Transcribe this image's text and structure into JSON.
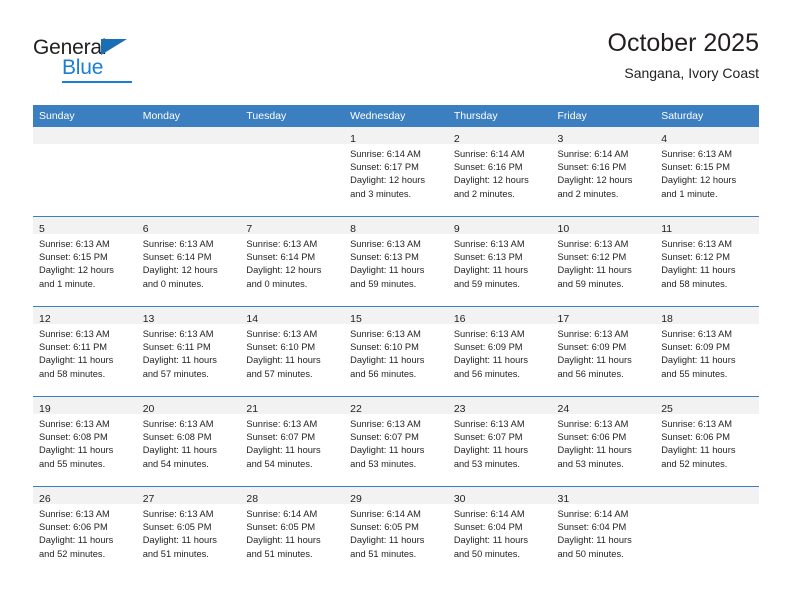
{
  "brand": {
    "name_top": "General",
    "name_bottom": "Blue",
    "triangle_color": "#1a6fb4",
    "blue_color": "#1a7fd4"
  },
  "header": {
    "title": "October 2025",
    "subtitle": "Sangana, Ivory Coast"
  },
  "theme": {
    "header_bar": "#3c7fc0",
    "daynum_band": "#f2f2f2",
    "text": "#231f20",
    "cell_bg": "#ffffff"
  },
  "weekday_headers": [
    "Sunday",
    "Monday",
    "Tuesday",
    "Wednesday",
    "Thursday",
    "Friday",
    "Saturday"
  ],
  "weeks": [
    [
      {
        "empty": true
      },
      {
        "empty": true
      },
      {
        "empty": true
      },
      {
        "day": "1",
        "sunrise": "Sunrise: 6:14 AM",
        "sunset": "Sunset: 6:17 PM",
        "daylight_l1": "Daylight: 12 hours",
        "daylight_l2": "and 3 minutes."
      },
      {
        "day": "2",
        "sunrise": "Sunrise: 6:14 AM",
        "sunset": "Sunset: 6:16 PM",
        "daylight_l1": "Daylight: 12 hours",
        "daylight_l2": "and 2 minutes."
      },
      {
        "day": "3",
        "sunrise": "Sunrise: 6:14 AM",
        "sunset": "Sunset: 6:16 PM",
        "daylight_l1": "Daylight: 12 hours",
        "daylight_l2": "and 2 minutes."
      },
      {
        "day": "4",
        "sunrise": "Sunrise: 6:13 AM",
        "sunset": "Sunset: 6:15 PM",
        "daylight_l1": "Daylight: 12 hours",
        "daylight_l2": "and 1 minute."
      }
    ],
    [
      {
        "day": "5",
        "sunrise": "Sunrise: 6:13 AM",
        "sunset": "Sunset: 6:15 PM",
        "daylight_l1": "Daylight: 12 hours",
        "daylight_l2": "and 1 minute."
      },
      {
        "day": "6",
        "sunrise": "Sunrise: 6:13 AM",
        "sunset": "Sunset: 6:14 PM",
        "daylight_l1": "Daylight: 12 hours",
        "daylight_l2": "and 0 minutes."
      },
      {
        "day": "7",
        "sunrise": "Sunrise: 6:13 AM",
        "sunset": "Sunset: 6:14 PM",
        "daylight_l1": "Daylight: 12 hours",
        "daylight_l2": "and 0 minutes."
      },
      {
        "day": "8",
        "sunrise": "Sunrise: 6:13 AM",
        "sunset": "Sunset: 6:13 PM",
        "daylight_l1": "Daylight: 11 hours",
        "daylight_l2": "and 59 minutes."
      },
      {
        "day": "9",
        "sunrise": "Sunrise: 6:13 AM",
        "sunset": "Sunset: 6:13 PM",
        "daylight_l1": "Daylight: 11 hours",
        "daylight_l2": "and 59 minutes."
      },
      {
        "day": "10",
        "sunrise": "Sunrise: 6:13 AM",
        "sunset": "Sunset: 6:12 PM",
        "daylight_l1": "Daylight: 11 hours",
        "daylight_l2": "and 59 minutes."
      },
      {
        "day": "11",
        "sunrise": "Sunrise: 6:13 AM",
        "sunset": "Sunset: 6:12 PM",
        "daylight_l1": "Daylight: 11 hours",
        "daylight_l2": "and 58 minutes."
      }
    ],
    [
      {
        "day": "12",
        "sunrise": "Sunrise: 6:13 AM",
        "sunset": "Sunset: 6:11 PM",
        "daylight_l1": "Daylight: 11 hours",
        "daylight_l2": "and 58 minutes."
      },
      {
        "day": "13",
        "sunrise": "Sunrise: 6:13 AM",
        "sunset": "Sunset: 6:11 PM",
        "daylight_l1": "Daylight: 11 hours",
        "daylight_l2": "and 57 minutes."
      },
      {
        "day": "14",
        "sunrise": "Sunrise: 6:13 AM",
        "sunset": "Sunset: 6:10 PM",
        "daylight_l1": "Daylight: 11 hours",
        "daylight_l2": "and 57 minutes."
      },
      {
        "day": "15",
        "sunrise": "Sunrise: 6:13 AM",
        "sunset": "Sunset: 6:10 PM",
        "daylight_l1": "Daylight: 11 hours",
        "daylight_l2": "and 56 minutes."
      },
      {
        "day": "16",
        "sunrise": "Sunrise: 6:13 AM",
        "sunset": "Sunset: 6:09 PM",
        "daylight_l1": "Daylight: 11 hours",
        "daylight_l2": "and 56 minutes."
      },
      {
        "day": "17",
        "sunrise": "Sunrise: 6:13 AM",
        "sunset": "Sunset: 6:09 PM",
        "daylight_l1": "Daylight: 11 hours",
        "daylight_l2": "and 56 minutes."
      },
      {
        "day": "18",
        "sunrise": "Sunrise: 6:13 AM",
        "sunset": "Sunset: 6:09 PM",
        "daylight_l1": "Daylight: 11 hours",
        "daylight_l2": "and 55 minutes."
      }
    ],
    [
      {
        "day": "19",
        "sunrise": "Sunrise: 6:13 AM",
        "sunset": "Sunset: 6:08 PM",
        "daylight_l1": "Daylight: 11 hours",
        "daylight_l2": "and 55 minutes."
      },
      {
        "day": "20",
        "sunrise": "Sunrise: 6:13 AM",
        "sunset": "Sunset: 6:08 PM",
        "daylight_l1": "Daylight: 11 hours",
        "daylight_l2": "and 54 minutes."
      },
      {
        "day": "21",
        "sunrise": "Sunrise: 6:13 AM",
        "sunset": "Sunset: 6:07 PM",
        "daylight_l1": "Daylight: 11 hours",
        "daylight_l2": "and 54 minutes."
      },
      {
        "day": "22",
        "sunrise": "Sunrise: 6:13 AM",
        "sunset": "Sunset: 6:07 PM",
        "daylight_l1": "Daylight: 11 hours",
        "daylight_l2": "and 53 minutes."
      },
      {
        "day": "23",
        "sunrise": "Sunrise: 6:13 AM",
        "sunset": "Sunset: 6:07 PM",
        "daylight_l1": "Daylight: 11 hours",
        "daylight_l2": "and 53 minutes."
      },
      {
        "day": "24",
        "sunrise": "Sunrise: 6:13 AM",
        "sunset": "Sunset: 6:06 PM",
        "daylight_l1": "Daylight: 11 hours",
        "daylight_l2": "and 53 minutes."
      },
      {
        "day": "25",
        "sunrise": "Sunrise: 6:13 AM",
        "sunset": "Sunset: 6:06 PM",
        "daylight_l1": "Daylight: 11 hours",
        "daylight_l2": "and 52 minutes."
      }
    ],
    [
      {
        "day": "26",
        "sunrise": "Sunrise: 6:13 AM",
        "sunset": "Sunset: 6:06 PM",
        "daylight_l1": "Daylight: 11 hours",
        "daylight_l2": "and 52 minutes."
      },
      {
        "day": "27",
        "sunrise": "Sunrise: 6:13 AM",
        "sunset": "Sunset: 6:05 PM",
        "daylight_l1": "Daylight: 11 hours",
        "daylight_l2": "and 51 minutes."
      },
      {
        "day": "28",
        "sunrise": "Sunrise: 6:14 AM",
        "sunset": "Sunset: 6:05 PM",
        "daylight_l1": "Daylight: 11 hours",
        "daylight_l2": "and 51 minutes."
      },
      {
        "day": "29",
        "sunrise": "Sunrise: 6:14 AM",
        "sunset": "Sunset: 6:05 PM",
        "daylight_l1": "Daylight: 11 hours",
        "daylight_l2": "and 51 minutes."
      },
      {
        "day": "30",
        "sunrise": "Sunrise: 6:14 AM",
        "sunset": "Sunset: 6:04 PM",
        "daylight_l1": "Daylight: 11 hours",
        "daylight_l2": "and 50 minutes."
      },
      {
        "day": "31",
        "sunrise": "Sunrise: 6:14 AM",
        "sunset": "Sunset: 6:04 PM",
        "daylight_l1": "Daylight: 11 hours",
        "daylight_l2": "and 50 minutes."
      },
      {
        "empty": true
      }
    ]
  ]
}
